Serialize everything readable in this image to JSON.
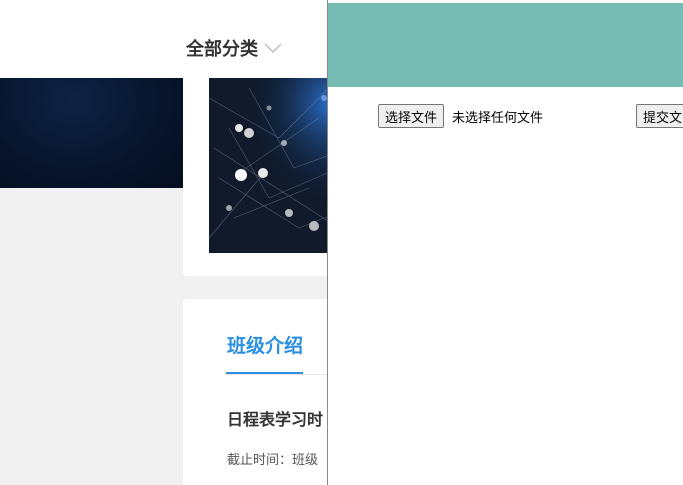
{
  "header": {
    "category_label": "全部分类",
    "category_icon": "chevron-down-icon"
  },
  "course_card": {
    "tab_label": "班级介绍",
    "title": "日程表学习时",
    "deadline_text": "截止时间：班级",
    "accent_color": "#2b8fe0"
  },
  "upload_panel": {
    "header_color": "#76bcb4",
    "choose_file_label": "选择文件",
    "no_file_text": "未选择任何文件",
    "submit_label": "提交文"
  }
}
